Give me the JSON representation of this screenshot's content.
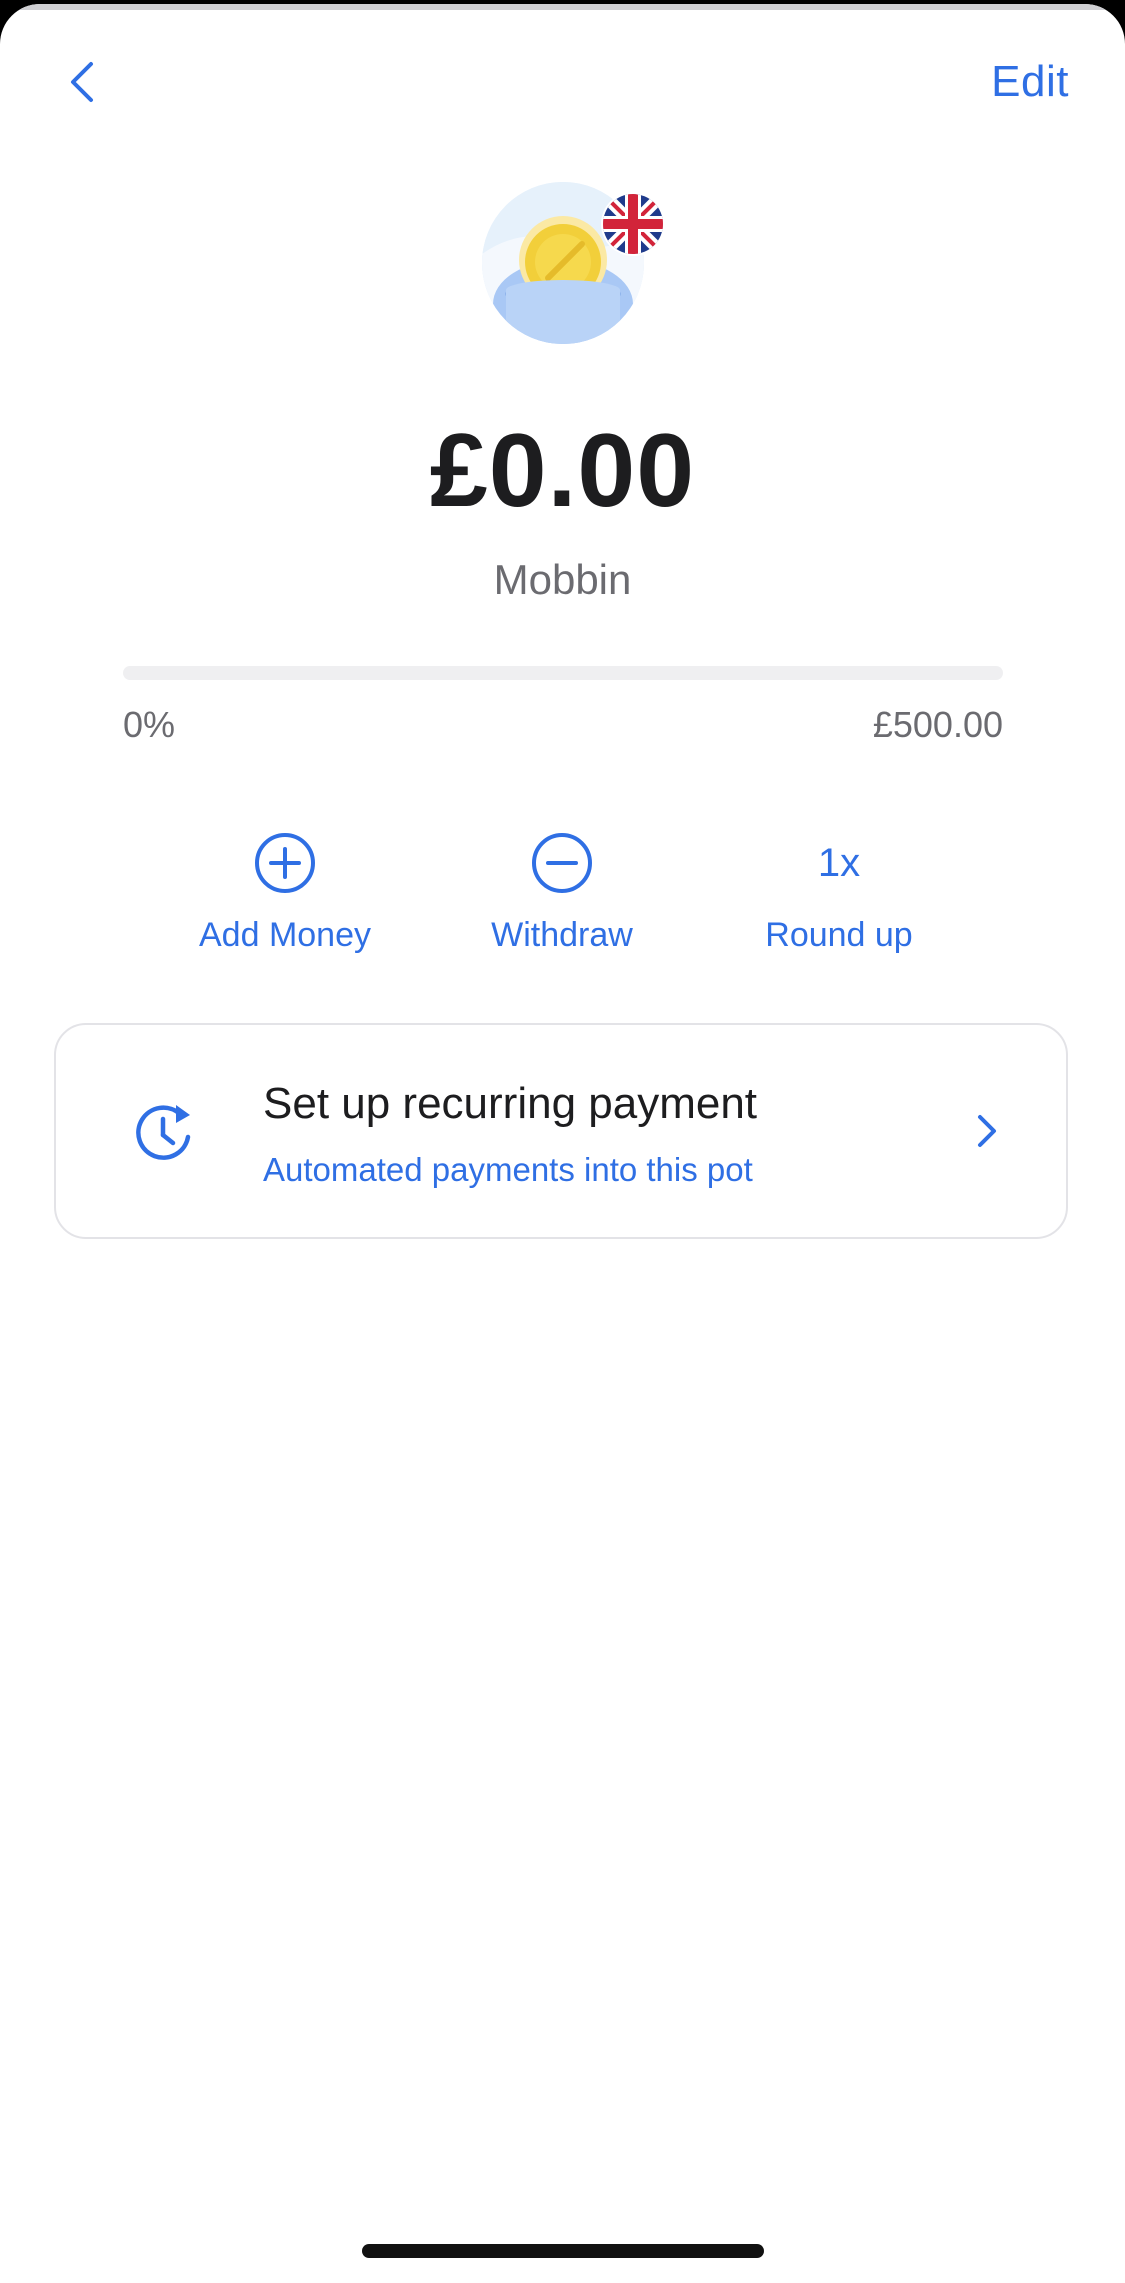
{
  "header": {
    "back_icon": "chevron-left-icon",
    "edit_label": "Edit"
  },
  "pot": {
    "avatar_icon": "coin-pot-icon",
    "flag_icon": "uk-flag-icon",
    "balance": "£0.00",
    "name": "Mobbin"
  },
  "progress": {
    "percent_label": "0%",
    "fraction": 0,
    "goal": "£500.00"
  },
  "actions": [
    {
      "icon": "plus-circle-icon",
      "label": "Add Money"
    },
    {
      "icon": "minus-circle-icon",
      "label": "Withdraw"
    },
    {
      "icon": "multiplier-text",
      "value": "1x",
      "label": "Round up"
    }
  ],
  "recurring_card": {
    "icon": "clock-refresh-icon",
    "title": "Set up recurring payment",
    "subtitle": "Automated payments into this pot",
    "chevron_icon": "chevron-right-icon"
  },
  "colors": {
    "accent": "#2f6fe4",
    "text_primary": "#1d1d1f",
    "text_secondary": "#6b6b70",
    "card_border": "#e3e3e7",
    "coin": "#f2cf3a"
  }
}
